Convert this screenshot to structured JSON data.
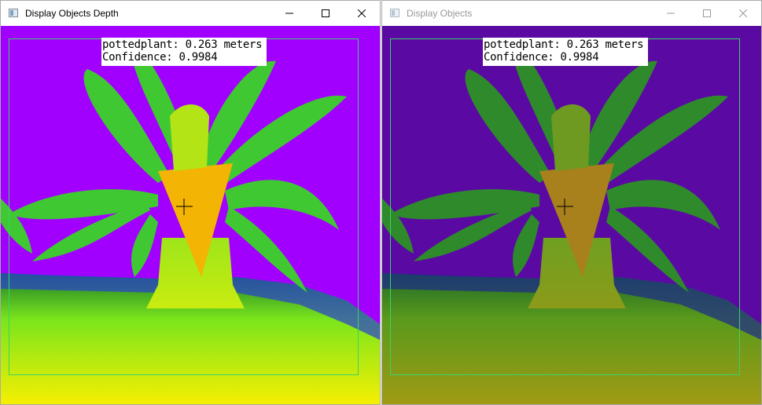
{
  "windows": [
    {
      "title": "Display Objects Depth",
      "active": true,
      "detection": {
        "label_line": "pottedplant: 0.263 meters",
        "confidence_line": "Confidence: 0.9984"
      }
    },
    {
      "title": "Display Objects",
      "active": false,
      "detection": {
        "label_line": "pottedplant: 0.263 meters",
        "confidence_line": "Confidence: 0.9984"
      }
    }
  ],
  "colors": {
    "bbox": "#3bd16a",
    "depth_background": "#a100ff",
    "plain_background": "#5a0aa2"
  }
}
